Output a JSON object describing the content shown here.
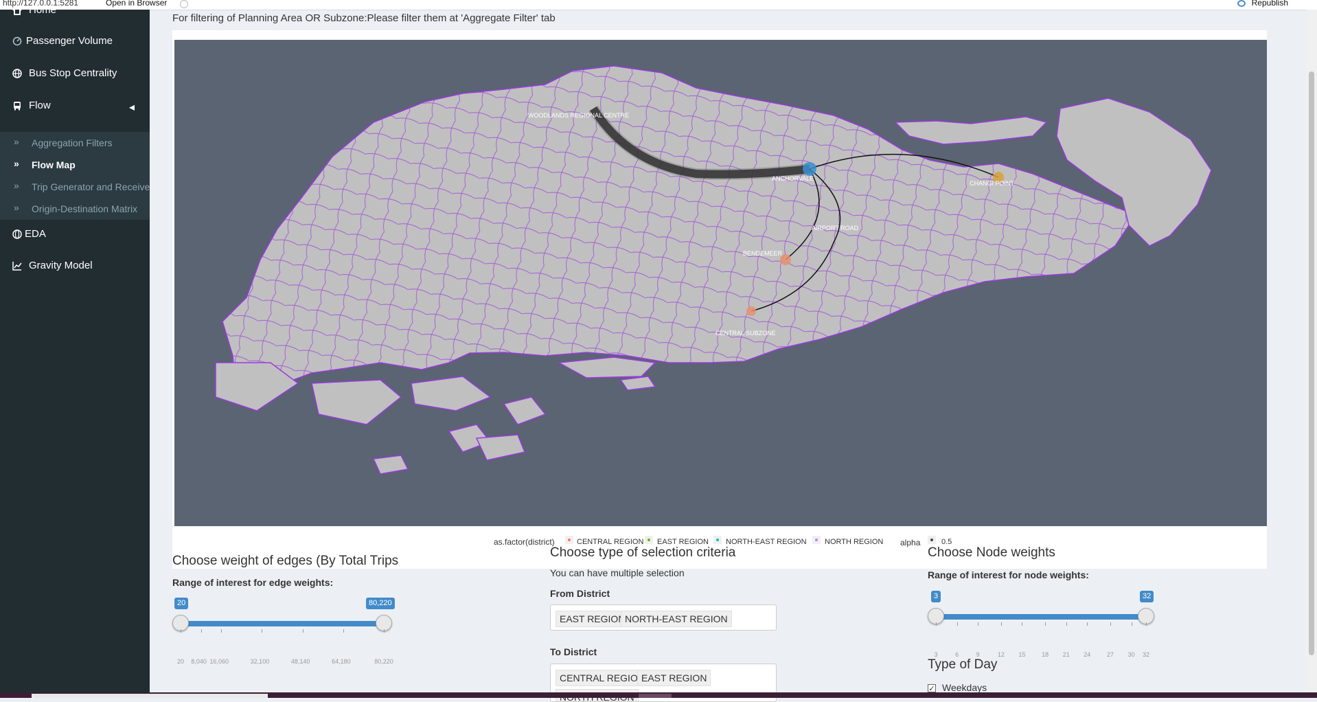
{
  "browser": {
    "url": "http://127.0.0.1:5281",
    "open_in_browser": "Open in Browser",
    "republish": "Republish"
  },
  "sidebar": {
    "home": "Home",
    "items": [
      {
        "label": "Passenger Volume",
        "icon": "dashboard-icon"
      },
      {
        "label": "Bus Stop Centrality",
        "icon": "globe-icon"
      },
      {
        "label": "Flow",
        "icon": "bus-icon"
      }
    ],
    "sub_items": [
      {
        "label": "Aggregation Filters"
      },
      {
        "label": "Flow Map"
      },
      {
        "label": "Trip Generator and Receiver"
      },
      {
        "label": "Origin-Destination Matrix"
      }
    ],
    "bottom_items": [
      {
        "label": "EDA",
        "icon": "globe-icon"
      },
      {
        "label": "Gravity Model",
        "icon": "line-chart-icon"
      }
    ]
  },
  "main": {
    "filter_note": "For filtering of Planning Area OR Subzone:Please filter them at 'Aggregate Filter' tab",
    "map": {
      "nodes": [
        {
          "label": "WOODLANDS REGIONAL CENTRE",
          "color": ""
        },
        {
          "label": "ANCHORVALE",
          "color": "#3a8fd0"
        },
        {
          "label": "CHANGI POINT",
          "color": "#d9a13a"
        },
        {
          "label": "AIRPORT ROAD",
          "color": ""
        },
        {
          "label": "BENDEMEER",
          "color": "#e8916e"
        },
        {
          "label": "CENTRAL SUBZONE",
          "color": "#e8916e"
        }
      ],
      "land_color": "#c0c0c0",
      "boundary_color": "#9b3ae0",
      "sea_color": "#5a6472"
    },
    "legend": {
      "title": "as.factor(district)",
      "entries": [
        "CENTRAL REGION",
        "EAST REGION",
        "NORTH-EAST REGION",
        "NORTH REGION"
      ],
      "entry_colors": [
        "#f8766d",
        "#7cae00",
        "#00bfc4",
        "#c77cff"
      ],
      "alpha_title": "alpha",
      "alpha_value": "0.5"
    },
    "edges_section": {
      "title": "Choose weight of edges (By Total Trips",
      "range_label": "Range of interest for edge weights:",
      "min": 20,
      "max": 80220,
      "value_low": "20",
      "value_high": "80,220",
      "ticks": [
        "20",
        "8,040",
        "16,060",
        "32,100",
        "48,140",
        "64,180",
        "80,220"
      ]
    },
    "selection_section": {
      "title": "Choose type of selection criteria",
      "hint": "You can have multiple selection",
      "from_label": "From District",
      "from_values": [
        "EAST REGION",
        "NORTH-EAST REGION"
      ],
      "to_label": "To District",
      "to_values": [
        "CENTRAL REGION",
        "EAST REGION",
        "NORTH REGION"
      ]
    },
    "nodes_section": {
      "title": "Choose Node weights",
      "range_label": "Range of interest for node weights:",
      "min": 3,
      "max": 32,
      "value_low": "3",
      "value_high": "32",
      "ticks": [
        "3",
        "6",
        "9",
        "12",
        "15",
        "18",
        "21",
        "24",
        "27",
        "30",
        "32"
      ]
    },
    "day_section": {
      "title": "Type of Day",
      "options": [
        {
          "label": "Weekdays",
          "checked": true
        }
      ]
    }
  }
}
